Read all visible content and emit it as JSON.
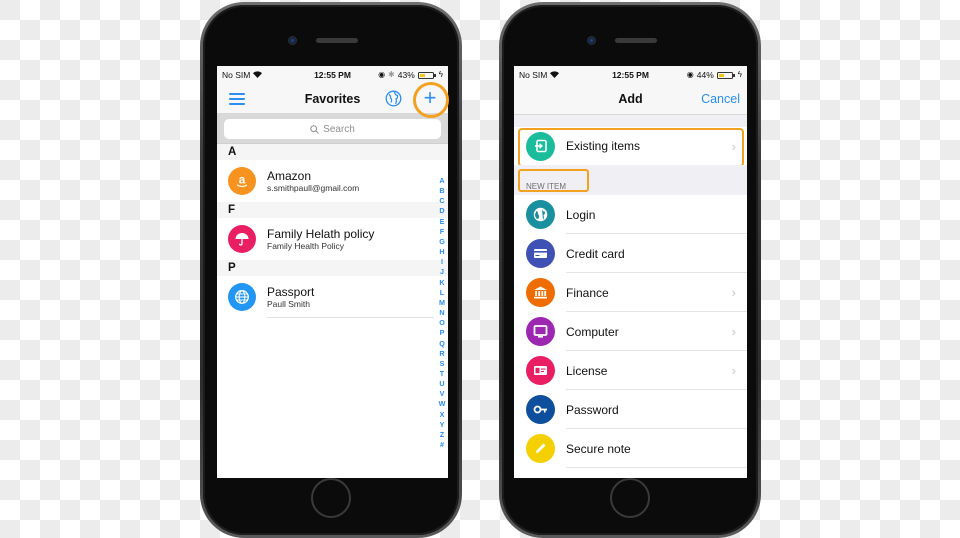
{
  "left_screen": {
    "statusbar": {
      "carrier": "No SIM",
      "time": "12:55 PM",
      "battery": "43%",
      "battery_fraction": 0.43
    },
    "navbar": {
      "title": "Favorites",
      "menu_icon": "hamburger-menu-icon",
      "globe_icon": "globe-icon",
      "add_icon": "plus-icon",
      "add_glyph": "+"
    },
    "search": {
      "placeholder": "Search",
      "icon": "search-icon",
      "glyph": "⚲"
    },
    "sections": [
      {
        "letter": "A",
        "items": [
          {
            "title": "Amazon",
            "subtitle": "s.smithpaull@gmail.com",
            "icon": "amazon-icon",
            "color": "#f7931e",
            "glyph": "a"
          }
        ]
      },
      {
        "letter": "F",
        "items": [
          {
            "title": "Family Helath policy",
            "subtitle": "Family Health Policy",
            "icon": "umbrella-icon",
            "color": "#e91e63",
            "glyph": "☂"
          }
        ]
      },
      {
        "letter": "P",
        "items": [
          {
            "title": "Passport",
            "subtitle": "Paull Smith",
            "icon": "globe-icon",
            "color": "#2196f3",
            "glyph": "🌐"
          }
        ]
      }
    ],
    "index": [
      "A",
      "B",
      "C",
      "D",
      "E",
      "F",
      "G",
      "H",
      "I",
      "J",
      "K",
      "L",
      "M",
      "N",
      "O",
      "P",
      "Q",
      "R",
      "S",
      "T",
      "U",
      "V",
      "W",
      "X",
      "Y",
      "Z",
      "#"
    ]
  },
  "right_screen": {
    "statusbar": {
      "carrier": "No SIM",
      "time": "12:55 PM",
      "battery": "44%",
      "battery_fraction": 0.44
    },
    "navbar": {
      "title": "Add",
      "cancel_label": "Cancel"
    },
    "existing": {
      "label": "Existing items",
      "icon": "import-icon",
      "color": "#1abc9c"
    },
    "new_item_header": "NEW ITEM",
    "items": [
      {
        "label": "Login",
        "icon": "globe-icon",
        "color": "#1a8fa0",
        "chevron": false
      },
      {
        "label": "Credit card",
        "icon": "credit-card-icon",
        "color": "#3f51b5",
        "chevron": false
      },
      {
        "label": "Finance",
        "icon": "bank-icon",
        "color": "#ef6c00",
        "chevron": true
      },
      {
        "label": "Computer",
        "icon": "monitor-icon",
        "color": "#9c27b0",
        "chevron": true
      },
      {
        "label": "License",
        "icon": "id-card-icon",
        "color": "#e91e63",
        "chevron": true
      },
      {
        "label": "Password",
        "icon": "key-icon",
        "color": "#0d4f9c",
        "chevron": false
      },
      {
        "label": "Secure note",
        "icon": "pencil-icon",
        "color": "#f5d000",
        "chevron": false
      }
    ],
    "chevron_glyph": "›"
  },
  "colors": {
    "accent": "#2b8ef0",
    "highlight": "#f2a220"
  }
}
